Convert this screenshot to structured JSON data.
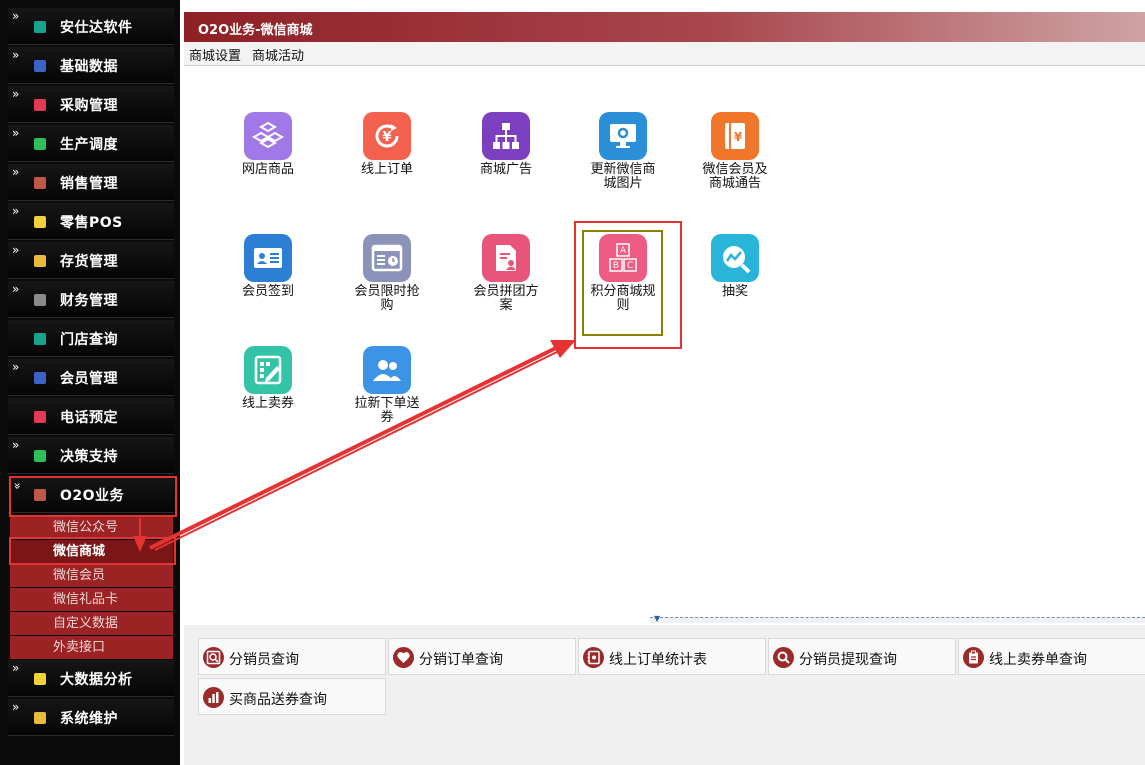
{
  "colors": {
    "sidebar_bg": "#0b0b0b",
    "submenu_bg": "#9b2323",
    "accent_red": "#e53333",
    "title_red": "#8e1f25"
  },
  "sidebar": {
    "items": [
      {
        "label": "安仕达软件",
        "chevron": "»",
        "icon_color": "#1aa38c"
      },
      {
        "label": "基础数据",
        "chevron": "»",
        "icon_color": "#3b63c7"
      },
      {
        "label": "采购管理",
        "chevron": "»",
        "icon_color": "#e23a55"
      },
      {
        "label": "生产调度",
        "chevron": "»",
        "icon_color": "#2fbf5a"
      },
      {
        "label": "销售管理",
        "chevron": "»",
        "icon_color": "#c0584a"
      },
      {
        "label": "零售POS",
        "chevron": "»",
        "icon_color": "#f2d13c"
      },
      {
        "label": "存货管理",
        "chevron": "»",
        "icon_color": "#e8b93a"
      },
      {
        "label": "财务管理",
        "chevron": "»",
        "icon_color": "#8a8a8a"
      },
      {
        "label": "门店查询",
        "chevron": "",
        "icon_color": "#1aa38c"
      },
      {
        "label": "会员管理",
        "chevron": "»",
        "icon_color": "#3b63c7"
      },
      {
        "label": "电话预定",
        "chevron": "",
        "icon_color": "#e23a55"
      },
      {
        "label": "决策支持",
        "chevron": "»",
        "icon_color": "#2fbf5a"
      },
      {
        "label": "O2O业务",
        "chevron": "»",
        "icon_color": "#c0584a"
      },
      {
        "label": "大数据分析",
        "chevron": "»",
        "icon_color": "#f2d13c"
      },
      {
        "label": "系统维护",
        "chevron": "»",
        "icon_color": "#e8b93a"
      }
    ],
    "o2o_submenu": [
      {
        "label": "微信公众号"
      },
      {
        "label": "微信商城"
      },
      {
        "label": "微信会员"
      },
      {
        "label": "微信礼品卡"
      },
      {
        "label": "自定义数据"
      },
      {
        "label": "外卖接口"
      }
    ]
  },
  "window": {
    "title": "O2O业务-微信商城",
    "menu": [
      "商城设置",
      "商城活动"
    ]
  },
  "tiles": [
    {
      "label": "网店商品",
      "icon": "cubes-icon",
      "color": "#a178e8"
    },
    {
      "label": "线上订单",
      "icon": "yen-refresh-icon",
      "color": "#f4614f"
    },
    {
      "label": "商城广告",
      "icon": "org-chart-icon",
      "color": "#7b3fbf"
    },
    {
      "label": "更新微信商城图片",
      "icon": "monitor-gear-icon",
      "color": "#2b8fd8"
    },
    {
      "label": "微信会员及商城通告",
      "icon": "yen-book-icon",
      "color": "#f0762c"
    },
    {
      "label": "会员签到",
      "icon": "id-card-icon",
      "color": "#2d7fd6"
    },
    {
      "label": "会员限时抢购",
      "icon": "timer-board-icon",
      "color": "#8b94b8"
    },
    {
      "label": "会员拼团方案",
      "icon": "document-user-icon",
      "color": "#e9547a"
    },
    {
      "label": "积分商城规则",
      "icon": "abc-blocks-icon",
      "color": "#ee5c84"
    },
    {
      "label": "抽奖",
      "icon": "chart-search-icon",
      "color": "#29b4d9"
    },
    {
      "label": "线上卖券",
      "icon": "grid-edit-icon",
      "color": "#33c4a8"
    },
    {
      "label": "拉新下单送券",
      "icon": "users-icon",
      "color": "#3d93e6"
    }
  ],
  "quick_buttons": [
    {
      "label": "分销员查询",
      "icon": "search-doc-icon"
    },
    {
      "label": "分销订单查询",
      "icon": "heart-icon"
    },
    {
      "label": "线上订单统计表",
      "icon": "notebook-icon"
    },
    {
      "label": "分销员提现查询",
      "icon": "search-icon"
    },
    {
      "label": "线上卖券单查询",
      "icon": "clipboard-icon"
    },
    {
      "label": "买商品送券查询",
      "icon": "bar-chart-icon"
    }
  ]
}
